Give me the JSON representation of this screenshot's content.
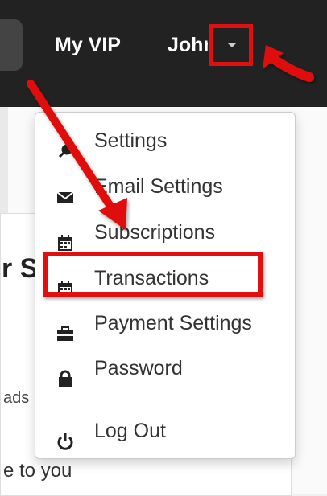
{
  "navbar": {
    "my_vip": "My VIP",
    "user_name": "John"
  },
  "dropdown": {
    "items": [
      {
        "label": "Settings",
        "icon": "wrench-icon"
      },
      {
        "label": "Email Settings",
        "icon": "envelope-icon"
      },
      {
        "label": "Subscriptions",
        "icon": "calendar-icon"
      },
      {
        "label": "Transactions",
        "icon": "calendar-icon"
      },
      {
        "label": "Payment Settings",
        "icon": "briefcase-icon"
      },
      {
        "label": "Password",
        "icon": "lock-icon"
      },
      {
        "label": "Log Out",
        "icon": "power-icon"
      }
    ]
  },
  "content": {
    "heading": "r S",
    "text1": "ads",
    "text2": "e to you"
  },
  "colors": {
    "navbar": "#222222",
    "annotation_red": "#e01010"
  }
}
